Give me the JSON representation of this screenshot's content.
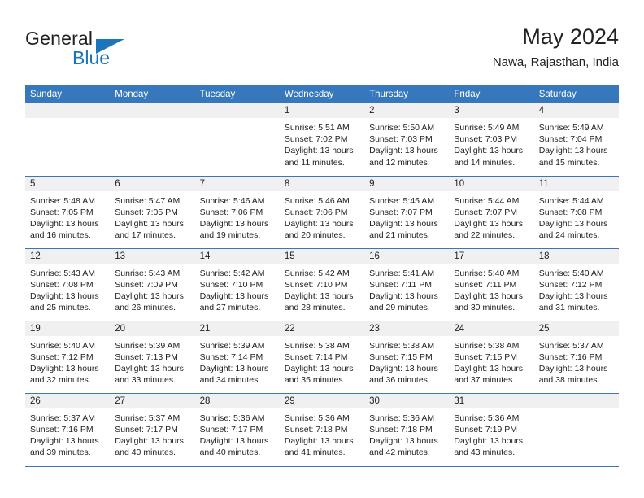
{
  "brand": {
    "name_part1": "General",
    "name_part2": "Blue",
    "primary_color": "#1b75bb",
    "header_color": "#3778bc",
    "band_color": "#f0f0f0"
  },
  "header": {
    "title": "May 2024",
    "subtitle": "Nawa, Rajasthan, India"
  },
  "calendar": {
    "weekday_headers": [
      "Sunday",
      "Monday",
      "Tuesday",
      "Wednesday",
      "Thursday",
      "Friday",
      "Saturday"
    ],
    "labels": {
      "sunrise": "Sunrise:",
      "sunset": "Sunset:",
      "daylight": "Daylight:"
    },
    "weeks": [
      [
        {
          "day": "",
          "empty": true
        },
        {
          "day": "",
          "empty": true
        },
        {
          "day": "",
          "empty": true
        },
        {
          "day": "1",
          "sunrise": "Sunrise: 5:51 AM",
          "sunset": "Sunset: 7:02 PM",
          "daylight_line1": "Daylight: 13 hours",
          "daylight_line2": "and 11 minutes."
        },
        {
          "day": "2",
          "sunrise": "Sunrise: 5:50 AM",
          "sunset": "Sunset: 7:03 PM",
          "daylight_line1": "Daylight: 13 hours",
          "daylight_line2": "and 12 minutes."
        },
        {
          "day": "3",
          "sunrise": "Sunrise: 5:49 AM",
          "sunset": "Sunset: 7:03 PM",
          "daylight_line1": "Daylight: 13 hours",
          "daylight_line2": "and 14 minutes."
        },
        {
          "day": "4",
          "sunrise": "Sunrise: 5:49 AM",
          "sunset": "Sunset: 7:04 PM",
          "daylight_line1": "Daylight: 13 hours",
          "daylight_line2": "and 15 minutes."
        }
      ],
      [
        {
          "day": "5",
          "sunrise": "Sunrise: 5:48 AM",
          "sunset": "Sunset: 7:05 PM",
          "daylight_line1": "Daylight: 13 hours",
          "daylight_line2": "and 16 minutes."
        },
        {
          "day": "6",
          "sunrise": "Sunrise: 5:47 AM",
          "sunset": "Sunset: 7:05 PM",
          "daylight_line1": "Daylight: 13 hours",
          "daylight_line2": "and 17 minutes."
        },
        {
          "day": "7",
          "sunrise": "Sunrise: 5:46 AM",
          "sunset": "Sunset: 7:06 PM",
          "daylight_line1": "Daylight: 13 hours",
          "daylight_line2": "and 19 minutes."
        },
        {
          "day": "8",
          "sunrise": "Sunrise: 5:46 AM",
          "sunset": "Sunset: 7:06 PM",
          "daylight_line1": "Daylight: 13 hours",
          "daylight_line2": "and 20 minutes."
        },
        {
          "day": "9",
          "sunrise": "Sunrise: 5:45 AM",
          "sunset": "Sunset: 7:07 PM",
          "daylight_line1": "Daylight: 13 hours",
          "daylight_line2": "and 21 minutes."
        },
        {
          "day": "10",
          "sunrise": "Sunrise: 5:44 AM",
          "sunset": "Sunset: 7:07 PM",
          "daylight_line1": "Daylight: 13 hours",
          "daylight_line2": "and 22 minutes."
        },
        {
          "day": "11",
          "sunrise": "Sunrise: 5:44 AM",
          "sunset": "Sunset: 7:08 PM",
          "daylight_line1": "Daylight: 13 hours",
          "daylight_line2": "and 24 minutes."
        }
      ],
      [
        {
          "day": "12",
          "sunrise": "Sunrise: 5:43 AM",
          "sunset": "Sunset: 7:08 PM",
          "daylight_line1": "Daylight: 13 hours",
          "daylight_line2": "and 25 minutes."
        },
        {
          "day": "13",
          "sunrise": "Sunrise: 5:43 AM",
          "sunset": "Sunset: 7:09 PM",
          "daylight_line1": "Daylight: 13 hours",
          "daylight_line2": "and 26 minutes."
        },
        {
          "day": "14",
          "sunrise": "Sunrise: 5:42 AM",
          "sunset": "Sunset: 7:10 PM",
          "daylight_line1": "Daylight: 13 hours",
          "daylight_line2": "and 27 minutes."
        },
        {
          "day": "15",
          "sunrise": "Sunrise: 5:42 AM",
          "sunset": "Sunset: 7:10 PM",
          "daylight_line1": "Daylight: 13 hours",
          "daylight_line2": "and 28 minutes."
        },
        {
          "day": "16",
          "sunrise": "Sunrise: 5:41 AM",
          "sunset": "Sunset: 7:11 PM",
          "daylight_line1": "Daylight: 13 hours",
          "daylight_line2": "and 29 minutes."
        },
        {
          "day": "17",
          "sunrise": "Sunrise: 5:40 AM",
          "sunset": "Sunset: 7:11 PM",
          "daylight_line1": "Daylight: 13 hours",
          "daylight_line2": "and 30 minutes."
        },
        {
          "day": "18",
          "sunrise": "Sunrise: 5:40 AM",
          "sunset": "Sunset: 7:12 PM",
          "daylight_line1": "Daylight: 13 hours",
          "daylight_line2": "and 31 minutes."
        }
      ],
      [
        {
          "day": "19",
          "sunrise": "Sunrise: 5:40 AM",
          "sunset": "Sunset: 7:12 PM",
          "daylight_line1": "Daylight: 13 hours",
          "daylight_line2": "and 32 minutes."
        },
        {
          "day": "20",
          "sunrise": "Sunrise: 5:39 AM",
          "sunset": "Sunset: 7:13 PM",
          "daylight_line1": "Daylight: 13 hours",
          "daylight_line2": "and 33 minutes."
        },
        {
          "day": "21",
          "sunrise": "Sunrise: 5:39 AM",
          "sunset": "Sunset: 7:14 PM",
          "daylight_line1": "Daylight: 13 hours",
          "daylight_line2": "and 34 minutes."
        },
        {
          "day": "22",
          "sunrise": "Sunrise: 5:38 AM",
          "sunset": "Sunset: 7:14 PM",
          "daylight_line1": "Daylight: 13 hours",
          "daylight_line2": "and 35 minutes."
        },
        {
          "day": "23",
          "sunrise": "Sunrise: 5:38 AM",
          "sunset": "Sunset: 7:15 PM",
          "daylight_line1": "Daylight: 13 hours",
          "daylight_line2": "and 36 minutes."
        },
        {
          "day": "24",
          "sunrise": "Sunrise: 5:38 AM",
          "sunset": "Sunset: 7:15 PM",
          "daylight_line1": "Daylight: 13 hours",
          "daylight_line2": "and 37 minutes."
        },
        {
          "day": "25",
          "sunrise": "Sunrise: 5:37 AM",
          "sunset": "Sunset: 7:16 PM",
          "daylight_line1": "Daylight: 13 hours",
          "daylight_line2": "and 38 minutes."
        }
      ],
      [
        {
          "day": "26",
          "sunrise": "Sunrise: 5:37 AM",
          "sunset": "Sunset: 7:16 PM",
          "daylight_line1": "Daylight: 13 hours",
          "daylight_line2": "and 39 minutes."
        },
        {
          "day": "27",
          "sunrise": "Sunrise: 5:37 AM",
          "sunset": "Sunset: 7:17 PM",
          "daylight_line1": "Daylight: 13 hours",
          "daylight_line2": "and 40 minutes."
        },
        {
          "day": "28",
          "sunrise": "Sunrise: 5:36 AM",
          "sunset": "Sunset: 7:17 PM",
          "daylight_line1": "Daylight: 13 hours",
          "daylight_line2": "and 40 minutes."
        },
        {
          "day": "29",
          "sunrise": "Sunrise: 5:36 AM",
          "sunset": "Sunset: 7:18 PM",
          "daylight_line1": "Daylight: 13 hours",
          "daylight_line2": "and 41 minutes."
        },
        {
          "day": "30",
          "sunrise": "Sunrise: 5:36 AM",
          "sunset": "Sunset: 7:18 PM",
          "daylight_line1": "Daylight: 13 hours",
          "daylight_line2": "and 42 minutes."
        },
        {
          "day": "31",
          "sunrise": "Sunrise: 5:36 AM",
          "sunset": "Sunset: 7:19 PM",
          "daylight_line1": "Daylight: 13 hours",
          "daylight_line2": "and 43 minutes."
        },
        {
          "day": "",
          "empty": true
        }
      ]
    ]
  }
}
